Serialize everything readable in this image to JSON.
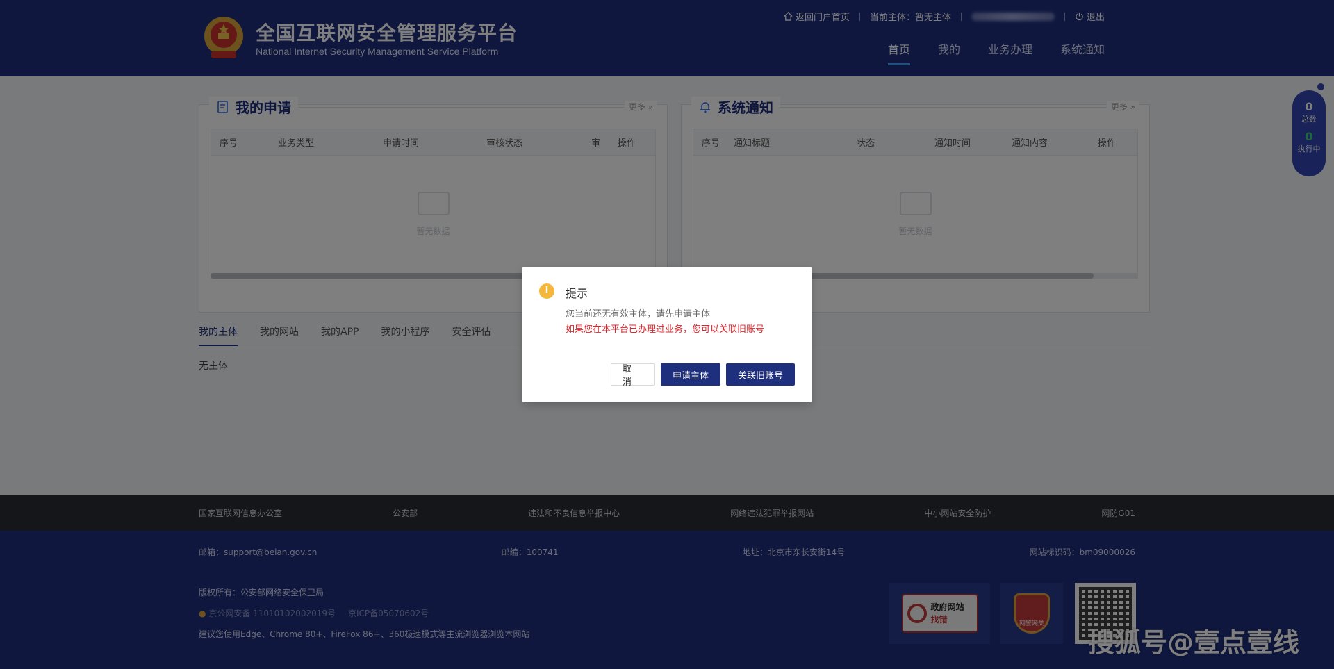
{
  "header": {
    "title": "全国互联网安全管理服务平台",
    "subtitle": "National Internet Security Management Service Platform",
    "topbar": {
      "home_link": "返回门户首页",
      "current_entity": "当前主体：暂无主体",
      "logout": "退出"
    },
    "nav": [
      {
        "label": "首页",
        "active": true
      },
      {
        "label": "我的"
      },
      {
        "label": "业务办理"
      },
      {
        "label": "系统通知"
      }
    ]
  },
  "my_applications": {
    "title": "我的申请",
    "more": "更多 »",
    "columns": [
      "序号",
      "业务类型",
      "申请时间",
      "审核状态",
      "审",
      "操作"
    ],
    "empty_text": "暂无数据"
  },
  "notifications": {
    "title": "系统通知",
    "more": "更多 »",
    "columns": [
      "序号",
      "通知标题",
      "状态",
      "通知时间",
      "通知内容",
      "操作"
    ],
    "empty_text": "暂无数据"
  },
  "tabs": [
    {
      "label": "我的主体",
      "active": true
    },
    {
      "label": "我的网站"
    },
    {
      "label": "我的APP"
    },
    {
      "label": "我的小程序"
    },
    {
      "label": "安全评估"
    }
  ],
  "entity_content": "无主体",
  "footer": {
    "links": [
      "国家互联网信息办公室",
      "公安部",
      "违法和不良信息举报中心",
      "网络违法犯罪举报网站",
      "中小网站安全防护",
      "网防G01"
    ],
    "email": "邮箱：support@beian.gov.cn",
    "postcode": "邮编：100741",
    "address": "地址：北京市东长安街14号",
    "site_code": "网站标识码：bm09000026",
    "copyright": "版权所有：公安部网络安全保卫局",
    "record_police": "京公网安备 11010102002019号",
    "record_icp": "京ICP备05070602号",
    "browser_tip": "建议您使用Edge、Chrome 80+、FireFox 86+、360极速模式等主流浏览器浏览本网站",
    "badge_gov": {
      "line1": "政府网站",
      "line2": "找错"
    },
    "badge_police": "网警网关"
  },
  "side_widget": {
    "total_count": "0",
    "total_label": "总数",
    "running_count": "0",
    "running_label": "执行中"
  },
  "watermark": "搜狐号@壹点壹线",
  "dialog": {
    "title": "提示",
    "message": "您当前还无有效主体，请先申请主体",
    "warning": "如果您在本平台已办理过业务，您可以关联旧账号",
    "cancel": "取 消",
    "apply": "申请主体",
    "link_account": "关联旧账号"
  }
}
